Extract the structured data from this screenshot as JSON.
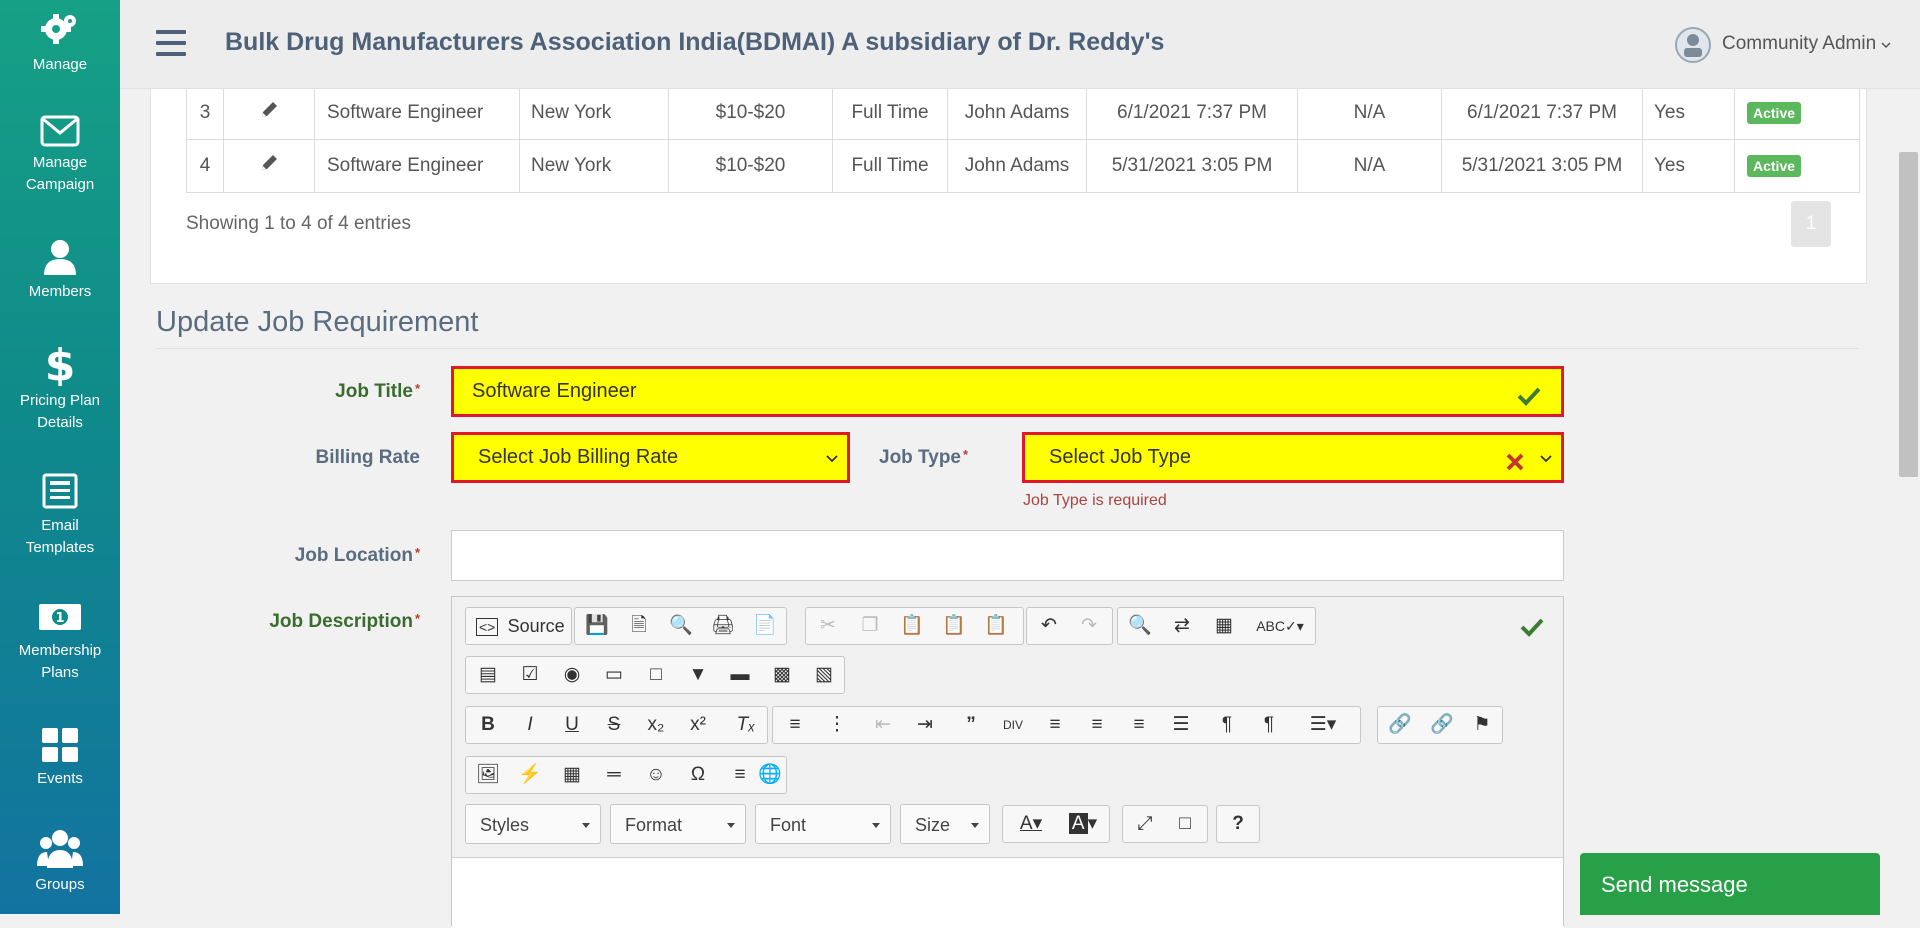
{
  "sidebar": {
    "items": [
      {
        "label": "Manage",
        "icon": "gear-icon"
      },
      {
        "label": "Manage Campaign",
        "icon": "envelope-icon"
      },
      {
        "label": "Members",
        "icon": "user-icon"
      },
      {
        "label": "Pricing Plan Details",
        "icon": "dollar-icon"
      },
      {
        "label": "Email Templates",
        "icon": "newspaper-icon"
      },
      {
        "label": "Membership Plans",
        "icon": "money-icon"
      },
      {
        "label": "Events",
        "icon": "grid-icon"
      },
      {
        "label": "Groups",
        "icon": "users-icon"
      }
    ]
  },
  "header": {
    "title": "Bulk Drug Manufacturers Association India(BDMAI) A subsidiary of Dr. Reddy's",
    "user": "Community Admin"
  },
  "table": {
    "rows": [
      {
        "num": "3",
        "title": "Software Engineer",
        "location": "New York",
        "rate": "$10-$20",
        "type": "Full Time",
        "posted_by": "John Adams",
        "created": "6/1/2021 7:37 PM",
        "na": "N/A",
        "updated": "6/1/2021 7:37 PM",
        "flag": "Yes",
        "status": "Active"
      },
      {
        "num": "4",
        "title": "Software Engineer",
        "location": "New York",
        "rate": "$10-$20",
        "type": "Full Time",
        "posted_by": "John Adams",
        "created": "5/31/2021 3:05 PM",
        "na": "N/A",
        "updated": "5/31/2021 3:05 PM",
        "flag": "Yes",
        "status": "Active"
      }
    ],
    "showing": "Showing 1 to 4 of 4 entries",
    "page": "1"
  },
  "form": {
    "section_title": "Update Job Requirement",
    "job_title_label": "Job Title",
    "job_title_value": "Software Engineer",
    "billing_rate_label": "Billing Rate",
    "billing_rate_value": "Select Job Billing Rate",
    "job_type_label": "Job Type",
    "job_type_value": "Select Job Type",
    "job_type_error": "Job Type is required",
    "job_location_label": "Job Location",
    "job_description_label": "Job Description",
    "required_mark": "*"
  },
  "editor": {
    "source_label": "Source",
    "styles_label": "Styles",
    "format_label": "Format",
    "font_label": "Font",
    "size_label": "Size"
  },
  "chat": {
    "send_label": "Send message"
  },
  "colors": {
    "sidebar_top": "#16a085",
    "sidebar_bottom": "#1273a0",
    "invalid_border": "#e0182d",
    "highlight": "#ffff00",
    "active_badge": "#5cb85c",
    "send_button": "#27a047"
  }
}
